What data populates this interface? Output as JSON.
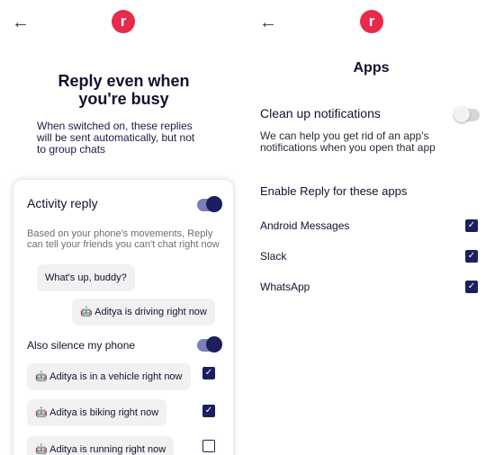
{
  "left": {
    "back_icon": "←",
    "logo_letter": "r",
    "headline_line1": "Reply even when",
    "headline_line2": "you're busy",
    "intro_line1": "When switched on, these replies",
    "intro_line2": "will be sent automatically, but not",
    "intro_line3": "to group chats",
    "card": {
      "title": "Activity reply",
      "toggle_on": true,
      "desc_line1": "Based on your phone's movements, Reply",
      "desc_line2": "can tell your friends you can't chat right now",
      "example_incoming": "What's up, buddy?",
      "example_reply": "🤖 Aditya is driving right now",
      "silence_label": "Also silence my phone",
      "silence_on": true,
      "activities": [
        {
          "label": "🤖 Aditya is in a vehicle right now",
          "checked": true
        },
        {
          "label": "🤖 Aditya is biking right now",
          "checked": true
        },
        {
          "label": "🤖 Aditya is running right now",
          "checked": false
        }
      ]
    }
  },
  "right": {
    "back_icon": "←",
    "logo_letter": "r",
    "title": "Apps",
    "cleanup_label": "Clean up notifications",
    "cleanup_on": false,
    "cleanup_desc_line1": "We can help you get rid of an app's",
    "cleanup_desc_line2": "notifications when you open that app",
    "enable_heading": "Enable Reply for these apps",
    "apps": [
      {
        "name": "Android Messages",
        "checked": true
      },
      {
        "name": "Slack",
        "checked": true
      },
      {
        "name": "WhatsApp",
        "checked": true
      }
    ]
  },
  "colors": {
    "brand": "#e8294a",
    "accent": "#1c1f5e"
  },
  "icons": {
    "back": "arrow-left-icon",
    "logo": "reply-logo-icon",
    "check": "checkmark-icon"
  }
}
